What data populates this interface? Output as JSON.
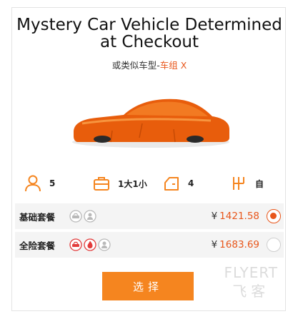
{
  "header": {
    "title": "Mystery Car Vehicle Determined at Checkout",
    "subtitle_prefix": "或类似车型-",
    "subtitle_group": "车组 X"
  },
  "specs": {
    "seats": "5",
    "luggage": "1大1小",
    "doors": "4",
    "transmission": "自"
  },
  "packages": [
    {
      "name": "基础套餐",
      "currency": "¥",
      "price": "1421.58",
      "selected": true
    },
    {
      "name": "全险套餐",
      "currency": "¥",
      "price": "1683.69",
      "selected": false
    }
  ],
  "actions": {
    "select_label": "选择"
  },
  "watermark": {
    "line1": "FLYERT",
    "line2": "飞客"
  },
  "colors": {
    "accent": "#e8561b",
    "button": "#f5851f"
  }
}
